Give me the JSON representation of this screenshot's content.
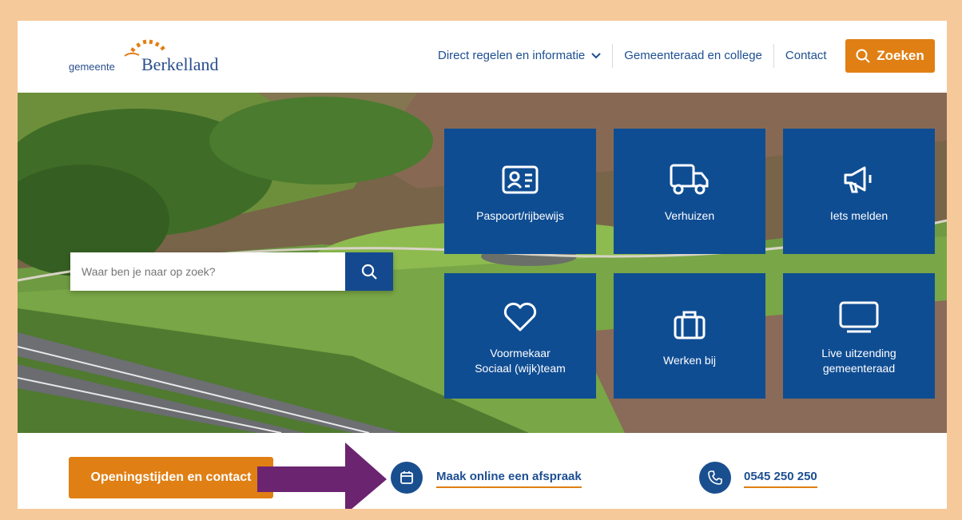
{
  "header": {
    "logo": {
      "small": "gemeente",
      "big": "Berkelland"
    },
    "nav": [
      {
        "label": "Direct regelen en informatie",
        "has_dropdown": true
      },
      {
        "label": "Gemeenteraad en college"
      },
      {
        "label": "Contact"
      }
    ],
    "search_button": "Zoeken"
  },
  "hero": {
    "search_placeholder": "Waar ben je naar op zoek?",
    "tiles": [
      {
        "label": "Paspoort/rijbewijs",
        "icon": "id-card-icon"
      },
      {
        "label": "Verhuizen",
        "icon": "truck-icon"
      },
      {
        "label": "Iets melden",
        "icon": "megaphone-icon"
      },
      {
        "label": "Voormekaar\nSociaal (wijk)team",
        "icon": "heart-icon"
      },
      {
        "label": "Werken bij",
        "icon": "briefcase-icon"
      },
      {
        "label": "Live uitzending\ngemeenteraad",
        "icon": "monitor-icon"
      }
    ]
  },
  "bottom": {
    "cta": "Openingstijden en contact",
    "appointment": "Maak online een afspraak",
    "phone": "0545 250 250"
  },
  "colors": {
    "brand_blue": "#0f4d93",
    "accent_orange": "#e07f14",
    "arrow_purple": "#6b2470",
    "frame_border": "#f6c99a"
  }
}
